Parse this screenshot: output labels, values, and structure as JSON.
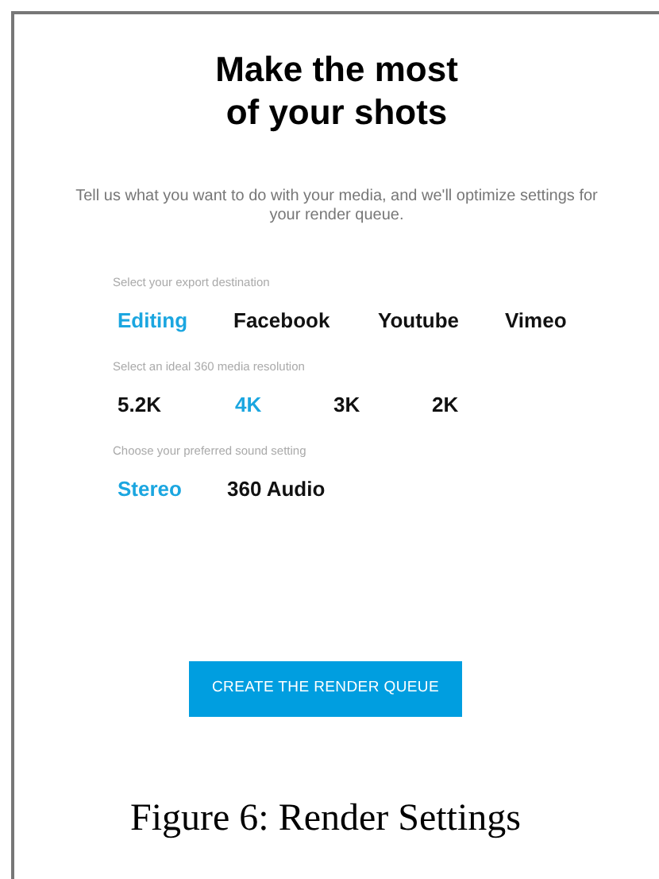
{
  "title": [
    "Make the most",
    "of your shots"
  ],
  "subtitle": "Tell us what you want to do with your media, and we'll optimize settings for your render queue.",
  "sections": [
    {
      "label": "Select your export destination",
      "options": [
        {
          "label": "Editing",
          "selected": true
        },
        {
          "label": "Facebook",
          "selected": false
        },
        {
          "label": "Youtube",
          "selected": false
        },
        {
          "label": "Vimeo",
          "selected": false
        }
      ]
    },
    {
      "label": "Select an ideal 360 media resolution",
      "options": [
        {
          "label": "5.2K",
          "selected": false
        },
        {
          "label": "4K",
          "selected": true
        },
        {
          "label": "3K",
          "selected": false
        },
        {
          "label": "2K",
          "selected": false
        }
      ]
    },
    {
      "label": "Choose your preferred sound setting",
      "options": [
        {
          "label": "Stereo",
          "selected": true
        },
        {
          "label": "360 Audio",
          "selected": false
        }
      ]
    }
  ],
  "button": "CREATE THE RENDER QUEUE",
  "caption": "Figure 6: Render Settings"
}
